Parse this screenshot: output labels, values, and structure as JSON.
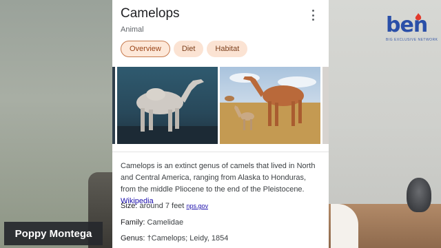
{
  "overlay": {
    "speaker_name": "Poppy Montega",
    "logo_text": "ben",
    "logo_subtitle": "BIG EXCLUSIVE NETWORK"
  },
  "card": {
    "title": "Camelops",
    "subtitle": "Animal",
    "chips": [
      {
        "label": "Overview",
        "active": true
      },
      {
        "label": "Diet",
        "active": false
      },
      {
        "label": "Habitat",
        "active": false
      }
    ],
    "description": "Camelops is an extinct genus of camels that lived in North and Central America, ranging from Alaska to Honduras, from the middle Pliocene to the end of the Pleistocene.",
    "description_link": "Wikipedia",
    "facts": [
      {
        "label": "Size:",
        "value": "around 7 feet",
        "source": "nps.gov"
      },
      {
        "label": "Family:",
        "value": "Camelidae",
        "source": ""
      },
      {
        "label": "Genus:",
        "value": "†Camelops; Leidy, 1854",
        "source": ""
      }
    ]
  },
  "colors": {
    "chip_bg": "#fbe3d3",
    "chip_text": "#7b3e1b",
    "link": "#1a0dab",
    "logo_blue": "#2a4fa8"
  }
}
